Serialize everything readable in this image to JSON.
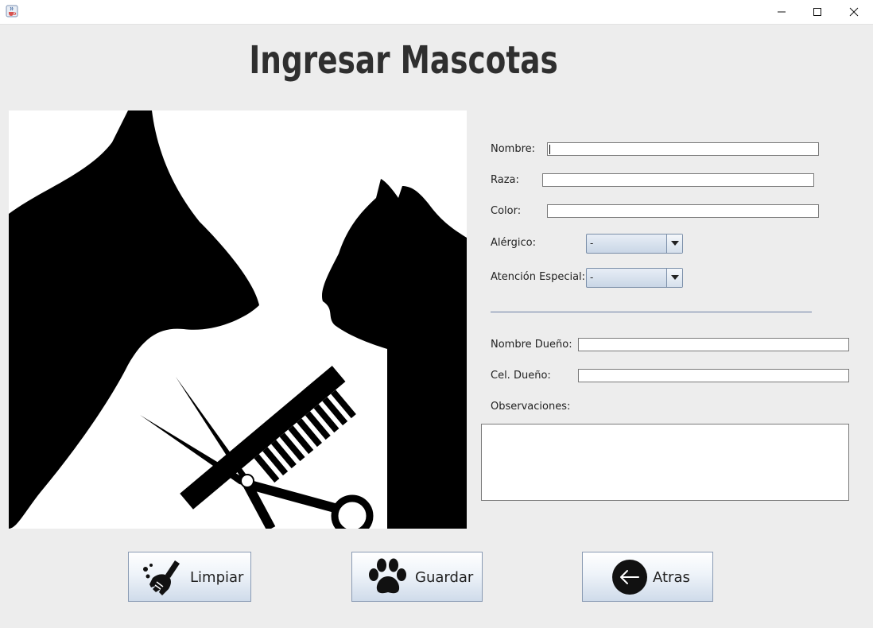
{
  "window": {
    "title": ""
  },
  "header": {
    "title": "Ingresar Mascotas"
  },
  "form": {
    "nombre_label": "Nombre:",
    "nombre_value": "",
    "raza_label": "Raza:",
    "raza_value": "",
    "color_label": "Color:",
    "color_value": "",
    "alergico_label": "Alérgico:",
    "alergico_value": "-",
    "atencion_label": "Atención Especial:",
    "atencion_value": "-",
    "dueno_label": "Nombre Dueño:",
    "dueno_value": "",
    "cel_label": "Cel. Dueño:",
    "cel_value": "",
    "observaciones_label": "Observaciones:",
    "observaciones_value": ""
  },
  "buttons": {
    "limpiar": "Limpiar",
    "guardar": "Guardar",
    "atras": "Atras"
  },
  "icons": {
    "app": "java-cup-icon",
    "limpiar": "broom-icon",
    "guardar": "paw-icon",
    "atras": "arrow-left-circle-icon"
  },
  "colors": {
    "background": "#ededed",
    "title": "#2f2f2f",
    "separator": "#6b7fa5",
    "button_border": "#8a9bb3"
  }
}
